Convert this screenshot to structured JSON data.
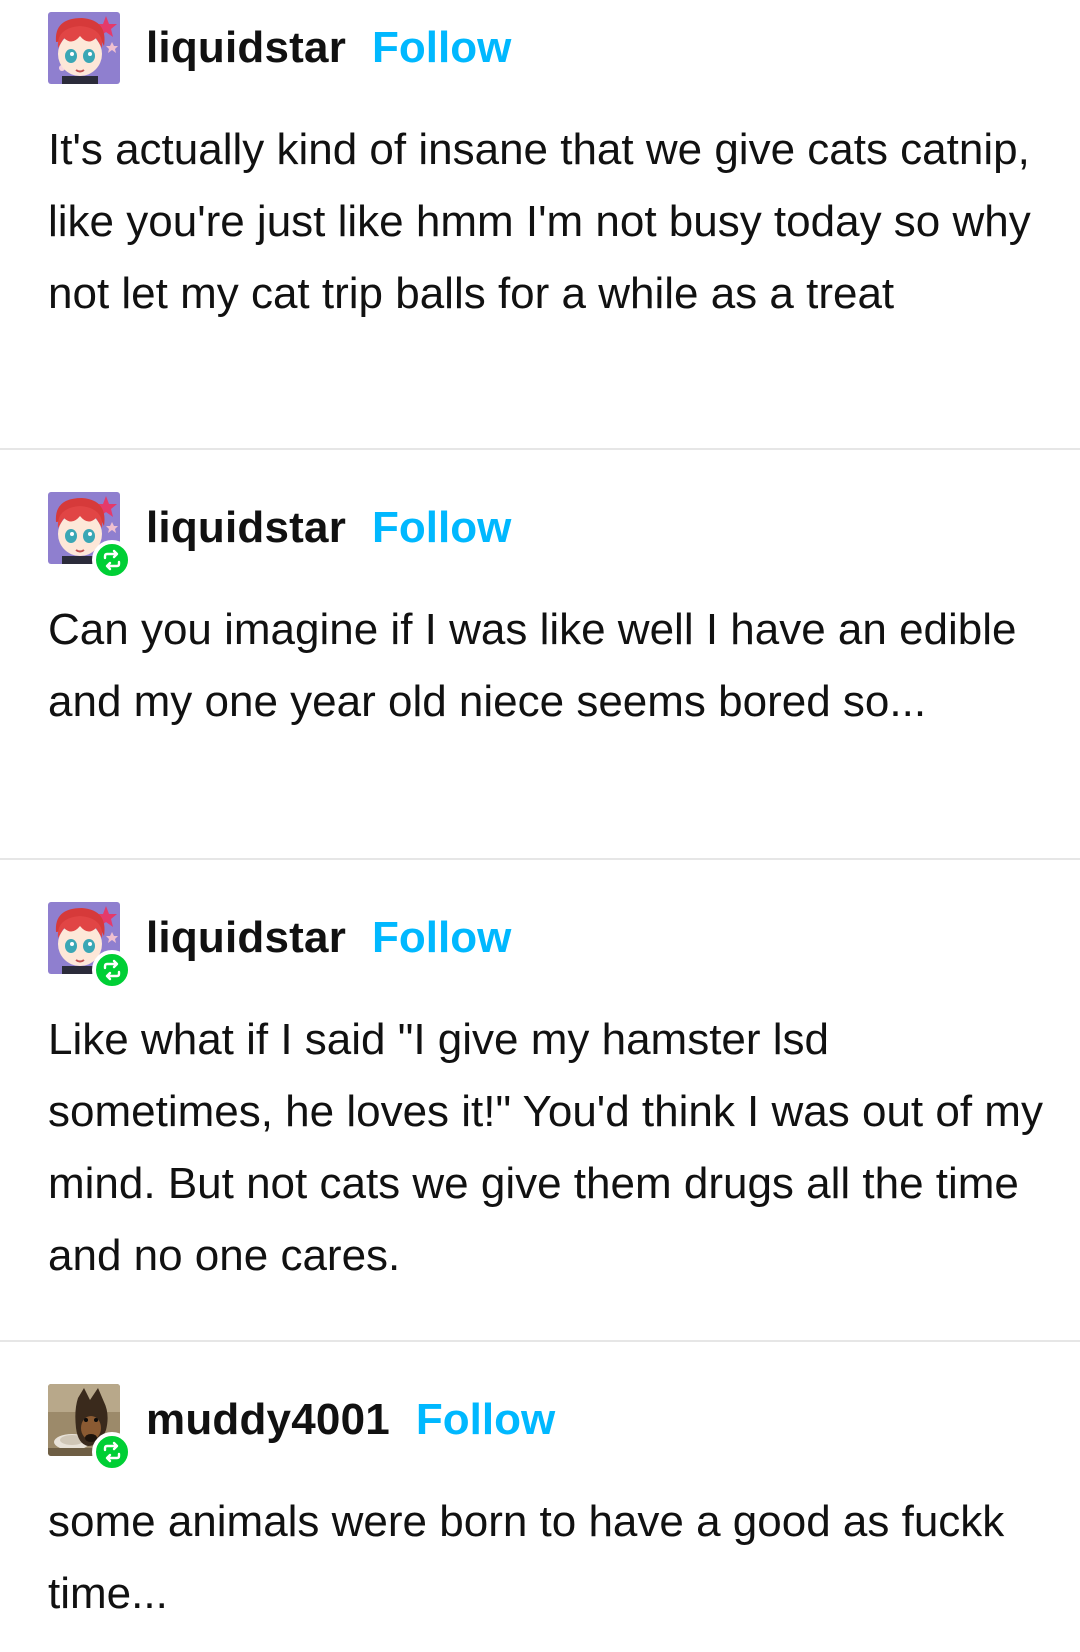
{
  "posts": [
    {
      "username": "liquidstar",
      "follow_label": "Follow",
      "is_reblog": false,
      "avatar": "anime-red-hair-avatar",
      "text": "It's actually kind of insane that we give cats catnip, like you're just like hmm I'm not busy today so why not let my cat trip balls for a while as a treat"
    },
    {
      "username": "liquidstar",
      "follow_label": "Follow",
      "is_reblog": true,
      "avatar": "anime-red-hair-avatar",
      "text": "Can you imagine if I was like well I have an edible and my one year old niece seems bored so..."
    },
    {
      "username": "liquidstar",
      "follow_label": "Follow",
      "is_reblog": true,
      "avatar": "anime-red-hair-avatar",
      "text": "Like what if I said \"I give my hamster lsd sometimes, he loves it!\" You'd think I was out of my mind. But not cats we give them drugs all the time and no one cares."
    },
    {
      "username": "muddy4001",
      "follow_label": "Follow",
      "is_reblog": true,
      "avatar": "puppy-photo-avatar",
      "text": "some animals were born to have a good as fuckk time..."
    }
  ],
  "colors": {
    "follow": "#00b8ff",
    "reblog_badge": "#00cf35",
    "divider": "#e6e6e6"
  },
  "icons": {
    "reblog": "reblog-icon"
  }
}
